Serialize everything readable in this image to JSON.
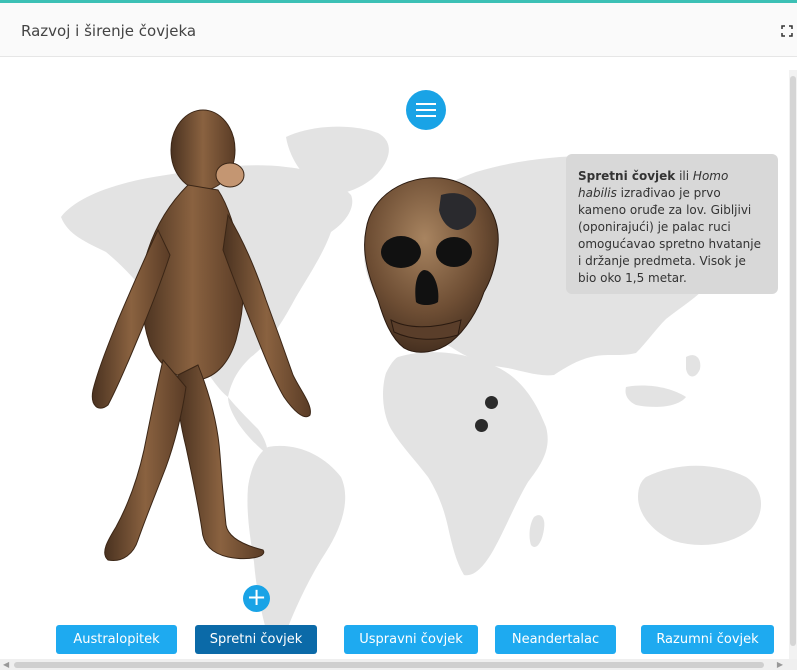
{
  "header": {
    "title": "Razvoj i širenje čovjeka",
    "fullscreen_icon": "expand-icon"
  },
  "menu_icon": "hamburger-menu-icon",
  "add_icon": "plus-icon",
  "info": {
    "name": "Spretni čovjek",
    "connector": " ili ",
    "latin": "Homo habilis",
    "text": "izrađivao je prvo kameno oruđe za lov. Gibljivi (oponirajući) je palac ruci omogućavao spretno hvatanje i držanje predmeta. Visok je bio oko 1,5 metar."
  },
  "tabs": [
    {
      "label": "Australopitek",
      "active": false
    },
    {
      "label": "Spretni čovjek",
      "active": true
    },
    {
      "label": "Uspravni čovjek",
      "active": false
    },
    {
      "label": "Neandertalac",
      "active": false
    },
    {
      "label": "Razumni čovjek",
      "active": false
    }
  ],
  "colors": {
    "accent": "#1eaaf0",
    "active_tab": "#0b6aa8",
    "top_line": "#3cc0b5",
    "info_bg": "#d8d8d8"
  }
}
